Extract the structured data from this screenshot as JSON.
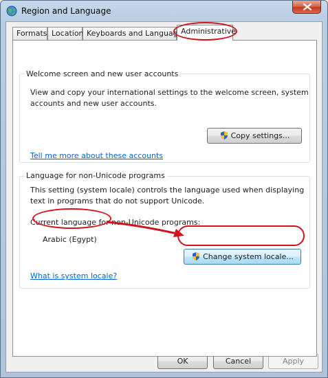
{
  "window": {
    "title": "Region and Language"
  },
  "tabs": [
    {
      "label": "Formats"
    },
    {
      "label": "Location"
    },
    {
      "label": "Keyboards and Languages"
    },
    {
      "label": "Administrative"
    }
  ],
  "welcome_group": {
    "title": "Welcome screen and new user accounts",
    "description_line1": "View and copy your international settings to the welcome screen, system",
    "description_line2": "accounts and new user accounts.",
    "copy_button_label": "Copy settings...",
    "link_text": "Tell me more about these accounts"
  },
  "nonunicode_group": {
    "title": "Language for non-Unicode programs",
    "description_line1": "This setting (system locale) controls the language used when displaying",
    "description_line2": "text in programs that do not support Unicode.",
    "current_label": "Current language for non-Unicode programs:",
    "current_value": "Arabic (Egypt)",
    "change_button_label": "Change system locale...",
    "link_text": "What is system locale?"
  },
  "footer": {
    "ok_label": "OK",
    "cancel_label": "Cancel",
    "apply_label": "Apply"
  },
  "colors": {
    "annotation": "#d0121e",
    "link": "#0066cc"
  },
  "icons": {
    "title": "globe-icon",
    "close": "close-icon",
    "uac": "uac-shield-icon"
  }
}
